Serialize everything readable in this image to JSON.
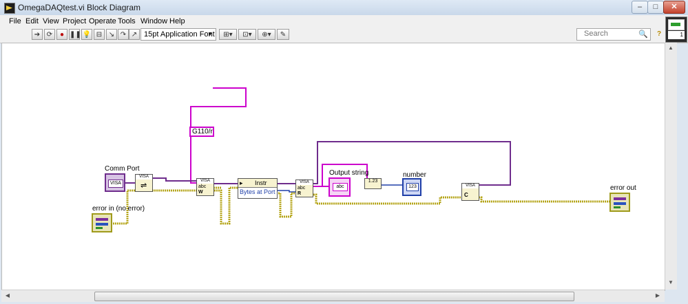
{
  "window": {
    "title": "OmegaDAQtest.vi Block Diagram",
    "minimize_glyph": "–",
    "maximize_glyph": "□",
    "close_glyph": "✕"
  },
  "menu": {
    "items": [
      "File",
      "Edit",
      "View",
      "Project",
      "Operate",
      "Tools",
      "Window",
      "Help"
    ]
  },
  "toolbar": {
    "font_select_value": "15pt Application Font",
    "search_placeholder": "Search",
    "icons": [
      "run-arrow-icon",
      "run-continuous-icon",
      "abort-icon",
      "pause-icon",
      "highlight-execution-icon",
      "retain-wire-values-icon",
      "step-into-icon",
      "step-over-icon",
      "step-out-icon",
      "align-objects-icon",
      "distribute-objects-icon",
      "reorder-icon",
      "cleanup-diagram-icon",
      "search-icon",
      "help-icon"
    ]
  },
  "connector_pane": {
    "index": "1"
  },
  "diagram": {
    "comm_port_label": "Comm Port",
    "error_in_label": "error in (no error)",
    "string_constant": "G110/r",
    "property_class": "Instr",
    "property_name": "Bytes at Port",
    "output_string_label": "Output string",
    "number_label": "number",
    "error_out_label": "error out",
    "visa_label": "VISA",
    "abc_label": "abc",
    "num_label": "123",
    "scan_label": "1.23"
  },
  "colors": {
    "string_wire": "#cc00cc",
    "error_wire": "#b5a51a",
    "visa_wire": "#6e2c8c",
    "numeric_wire": "#1f3fa8"
  }
}
